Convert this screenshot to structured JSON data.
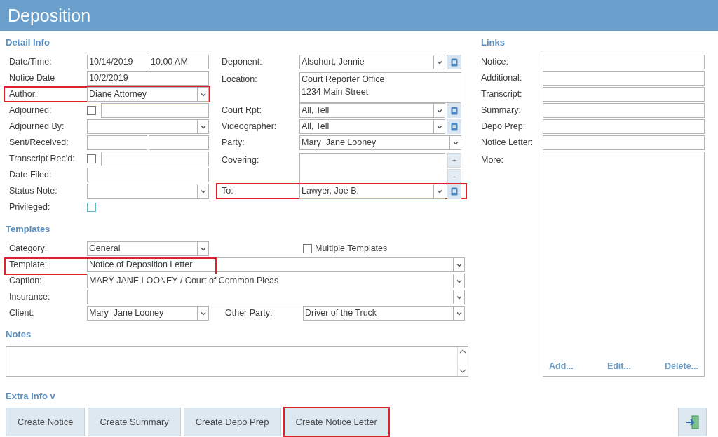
{
  "title": "Deposition",
  "detail_info": {
    "heading": "Detail Info",
    "left_fields": [
      {
        "label": "Date/Time:",
        "kind": "pair",
        "values": [
          "10/14/2019",
          "10:00 AM"
        ],
        "highlighted": false
      },
      {
        "label": "Notice Date",
        "kind": "text",
        "value": "10/2/2019",
        "highlighted": false
      },
      {
        "label": "Author:",
        "kind": "select",
        "value": "Diane Attorney",
        "highlighted": true
      },
      {
        "label": "Adjourned:",
        "kind": "check-text",
        "checked": false,
        "highlighted": false
      },
      {
        "label": "Adjourned By:",
        "kind": "select",
        "highlighted": false
      },
      {
        "label": "Sent/Received:",
        "kind": "pair",
        "highlighted": false
      },
      {
        "label": "Transcript Rec'd:",
        "kind": "check-text",
        "checked": false,
        "highlighted": false
      },
      {
        "label": "Date Filed:",
        "kind": "text",
        "highlighted": false
      },
      {
        "label": "Status Note:",
        "kind": "select",
        "highlighted": false
      },
      {
        "label": "Privileged:",
        "kind": "checkbox",
        "checked": false,
        "highlighted": false
      }
    ],
    "right_fields": [
      {
        "label": "Deponent:",
        "kind": "select-card",
        "value": "Alsohurt, Jennie",
        "highlighted": false
      },
      {
        "label": "Location:",
        "kind": "memo",
        "lines": [
          "Court Reporter Office",
          "1234 Main Street"
        ],
        "highlighted": false
      },
      {
        "label": "Court Rpt:",
        "kind": "select-card",
        "value": "All, Tell",
        "highlighted": false
      },
      {
        "label": "Videographer:",
        "kind": "select-card",
        "value": "All, Tell",
        "highlighted": false
      },
      {
        "label": "Party:",
        "kind": "select",
        "value": "Mary  Jane Looney",
        "highlighted": false
      },
      {
        "label": "Covering:",
        "kind": "list",
        "buttons": [
          "+",
          "-"
        ],
        "highlighted": false
      },
      {
        "label": "To:",
        "kind": "select-card",
        "value": "Lawyer, Joe B.",
        "highlighted": true
      }
    ]
  },
  "links": {
    "heading": "Links",
    "fields": [
      {
        "label": "Notice:"
      },
      {
        "label": "Additional:"
      },
      {
        "label": "Transcript:"
      },
      {
        "label": "Summary:"
      },
      {
        "label": "Depo Prep:"
      },
      {
        "label": "Notice Letter:"
      }
    ],
    "more": {
      "label": "More:",
      "actions": [
        "Add...",
        "Edit...",
        "Delete..."
      ]
    }
  },
  "templates": {
    "heading": "Templates",
    "rows": [
      {
        "label": "Category:",
        "kind": "short",
        "value": "General",
        "highlighted": false,
        "side": {
          "kind": "checkbox",
          "label": "Multiple Templates",
          "checked": false
        }
      },
      {
        "label": "Template:",
        "kind": "wide",
        "value": "Notice of Deposition Letter",
        "highlighted": true
      },
      {
        "label": "Caption:",
        "kind": "wide",
        "value": "MARY JANE LOONEY / Court of Common Pleas",
        "highlighted": false
      },
      {
        "label": "Insurance:",
        "kind": "wide",
        "highlighted": false
      },
      {
        "label": "Client:",
        "kind": "short",
        "value": "Mary  Jane Looney",
        "highlighted": false,
        "side": {
          "kind": "select",
          "label": "Other Party:",
          "value": "Driver of the Truck"
        }
      }
    ]
  },
  "notes": {
    "heading": "Notes"
  },
  "extra_info": {
    "label": "Extra Info v"
  },
  "buttons": [
    {
      "label": "Create Notice",
      "highlighted": false
    },
    {
      "label": "Create Summary",
      "highlighted": false
    },
    {
      "label": "Create Depo Prep",
      "highlighted": false
    },
    {
      "label": "Create Notice Letter",
      "highlighted": true
    }
  ]
}
